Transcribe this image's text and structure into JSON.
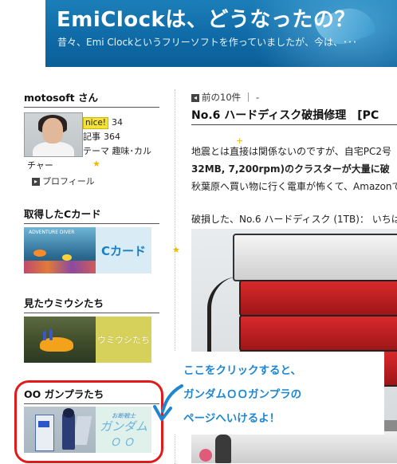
{
  "banner": {
    "title": "EmiClockは、どうなったの？",
    "subtitle": "昔々、Emi Clockというフリーソフトを作っていましたが、今は、･･･"
  },
  "profile": {
    "title": "motosoft さん",
    "nice_label": "nice!",
    "nice_count": "34",
    "articles_label": "記事",
    "articles_count": "364",
    "theme_label": "テーマ",
    "theme_value_1": "趣味･カル",
    "theme_value_2": "チャー",
    "profile_link": "プロフィール"
  },
  "sections": {
    "card": {
      "title": "取得したCカード",
      "label": "Cカード",
      "image_text": "ADVENTURE DIVER"
    },
    "umiushi": {
      "title": "見たウミウシたち",
      "label": "ウミウシたち"
    },
    "gunpla": {
      "title": "OO ガンプラたち",
      "label_small": "お断戦士",
      "label_big": "ガンダム",
      "label_oo": "ＯＯ"
    }
  },
  "main": {
    "prev_nav": "前の10件 ｜ -",
    "post_title": "No.6 ハードディスク破損修理　[PC",
    "p1": "地震とは直接は関係ないのですが、自宅PC2号",
    "p2": "32MB, 7,200rpm)のクラスターが大量に破",
    "p3": "秋葉原へ買い物に行く電車が怖くて、Amazonで",
    "p4": "破損した、No.6 ハードディスク (1TB)：  いちは"
  },
  "callout": {
    "line1": "ここをクリックすると、",
    "line2": "ガンダムＯＯガンプラの",
    "line3": "ページへいけるよ！"
  },
  "colors": {
    "banner": "#1576b3",
    "callout_text": "#1e86d0",
    "highlight_ring": "#e31a1a",
    "card_label": "#1a7fc8"
  },
  "icons": [
    "arrow-box-icon",
    "blue-pointer-arrow-icon",
    "star-icon"
  ]
}
